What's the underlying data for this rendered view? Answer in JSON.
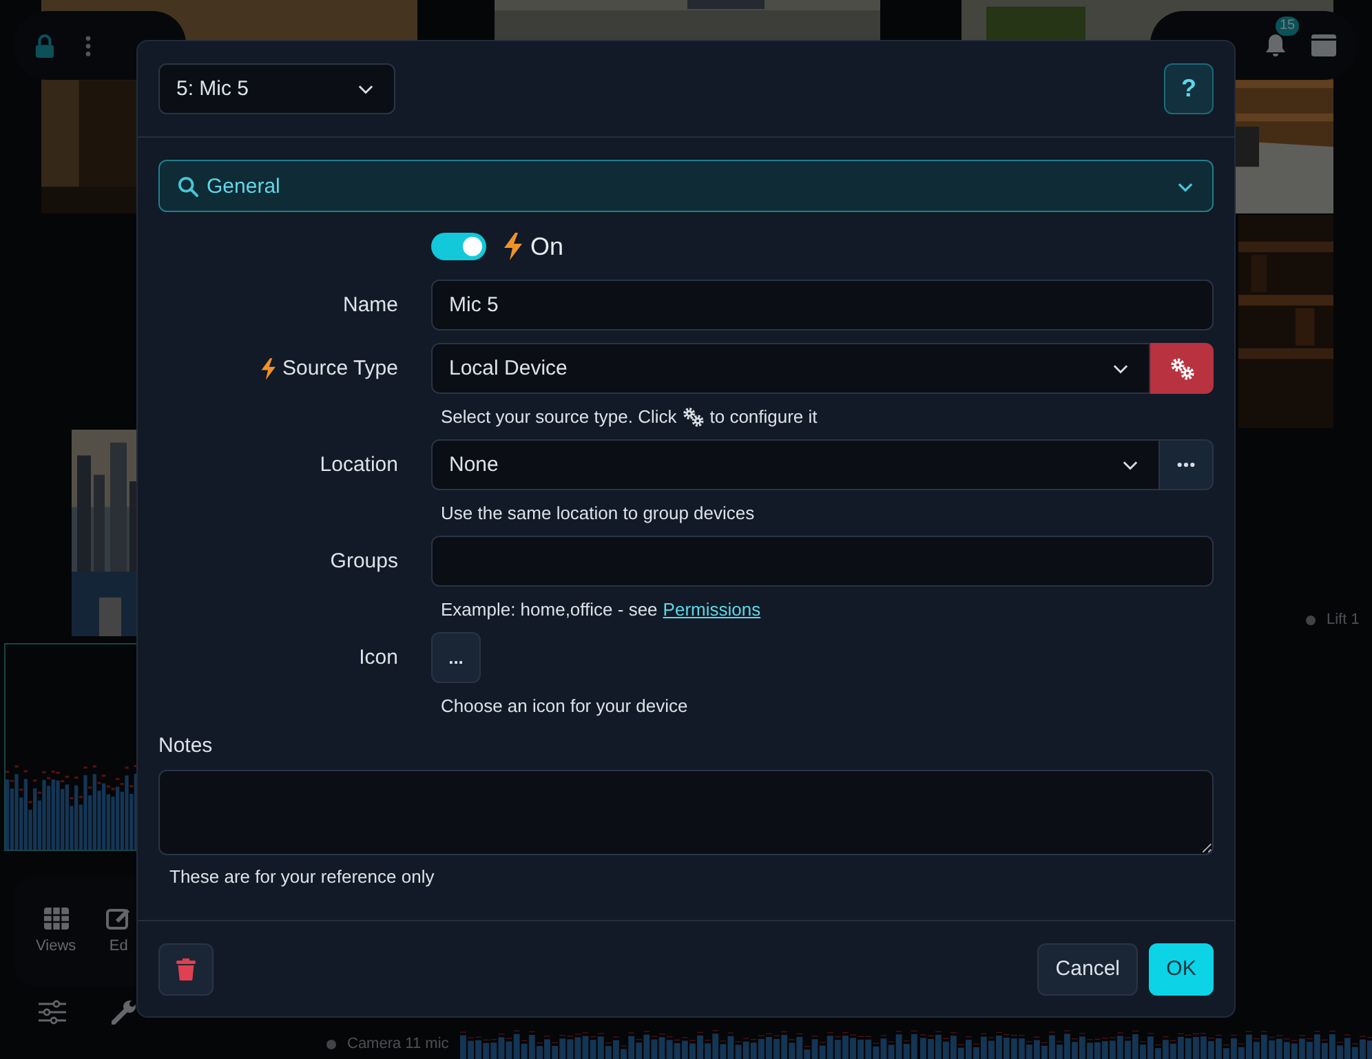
{
  "background": {
    "notification_count": "15",
    "bottom_toolbar": [
      {
        "label": "Views"
      },
      {
        "label": "Ed"
      }
    ],
    "tile_labels": [
      {
        "label": "Lift 1"
      },
      {
        "label": "Camera 11 mic"
      }
    ]
  },
  "dialog": {
    "device_select": "5: Mic 5",
    "help_button": "?",
    "section": {
      "label": "General"
    },
    "enabled": {
      "on": true,
      "label": "On"
    },
    "fields": [
      {
        "kind": "text",
        "label": "Name",
        "value": "Mic 5",
        "flagged": false
      },
      {
        "kind": "select",
        "label": "Source Type",
        "value": "Local Device",
        "flagged": true,
        "addon": {
          "kind": "configure"
        },
        "help": [
          "Select your source type. Click",
          "to configure it"
        ]
      },
      {
        "kind": "select",
        "label": "Location",
        "value": "None",
        "flagged": false,
        "addon": {
          "kind": "more"
        },
        "help": [
          "Use the same location to group devices"
        ]
      },
      {
        "kind": "text",
        "label": "Groups",
        "flagged": false,
        "help": [
          "Example: home,office - see"
        ],
        "link": "Permissions"
      },
      {
        "kind": "picker",
        "label": "Icon",
        "button": "...",
        "flagged": false,
        "help": [
          "Choose an icon for your device"
        ]
      }
    ],
    "notes": {
      "label": "Notes",
      "help": "These are for your reference only"
    },
    "buttons": [
      {
        "kind": "delete"
      },
      {
        "kind": "secondary",
        "label": "Cancel"
      },
      {
        "kind": "primary",
        "label": "OK"
      }
    ]
  }
}
